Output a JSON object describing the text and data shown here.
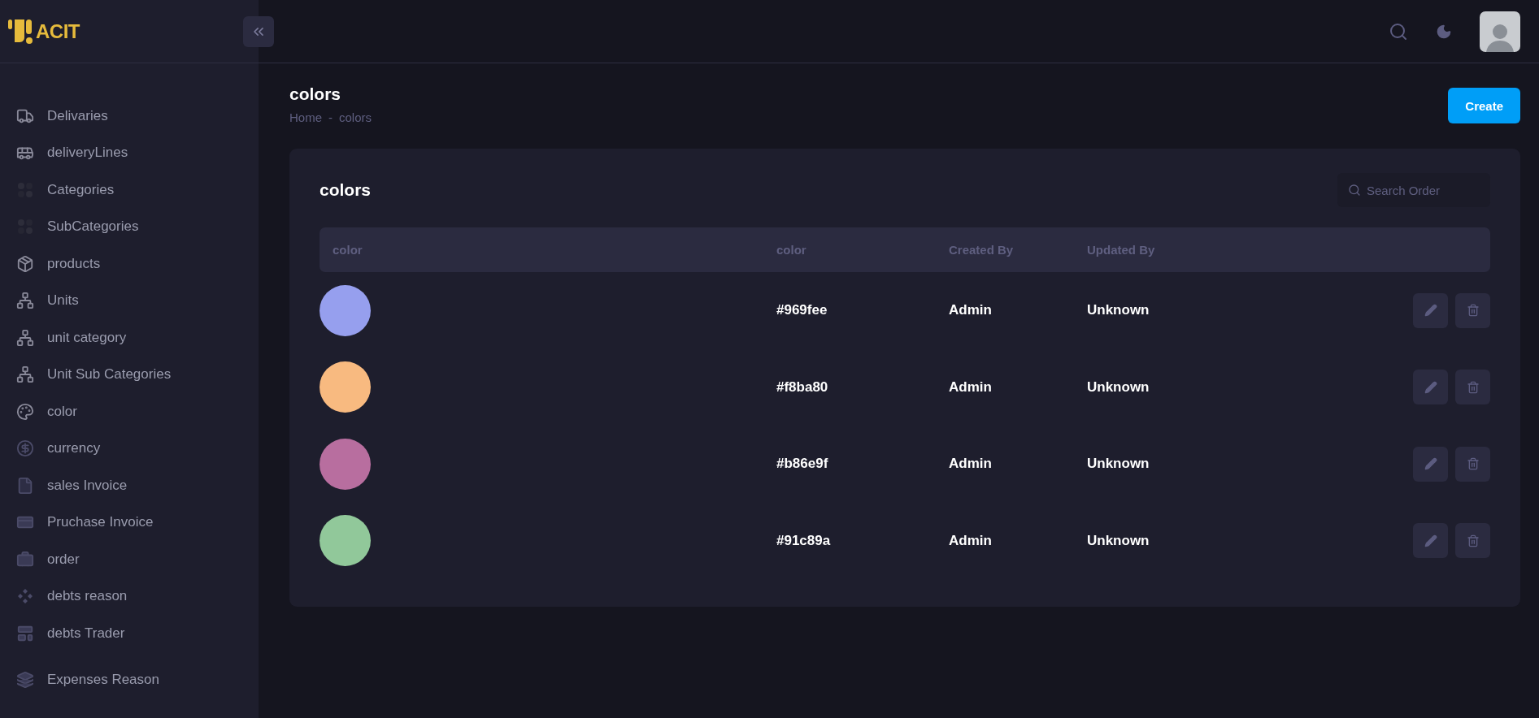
{
  "brand": {
    "name": "ACIT"
  },
  "sidebar": {
    "items": [
      {
        "label": "Delivaries",
        "kind": "truck"
      },
      {
        "label": "deliveryLines",
        "kind": "bus"
      },
      {
        "label": "Categories",
        "kind": "dots"
      },
      {
        "label": "SubCategories",
        "kind": "dots"
      },
      {
        "label": "products",
        "kind": "package"
      },
      {
        "label": "Units",
        "kind": "network"
      },
      {
        "label": "unit category",
        "kind": "network"
      },
      {
        "label": "Unit Sub Categories",
        "kind": "network"
      },
      {
        "label": "color",
        "kind": "palette"
      },
      {
        "label": "currency",
        "kind": "dollar"
      },
      {
        "label": "sales Invoice",
        "kind": "file"
      },
      {
        "label": "Pruchase Invoice",
        "kind": "card"
      },
      {
        "label": "order",
        "kind": "briefcase"
      },
      {
        "label": "debts reason",
        "kind": "diamonds"
      },
      {
        "label": "debts Trader",
        "kind": "layout"
      },
      {
        "label": "Expenses Reason",
        "kind": "layers"
      }
    ]
  },
  "page": {
    "title": "colors",
    "breadcrumb": [
      "Home",
      "colors"
    ],
    "breadcrumb_separator": "-",
    "create_button": "Create"
  },
  "card": {
    "title": "colors",
    "search": {
      "placeholder": "Search Order"
    }
  },
  "table": {
    "columns": [
      "color",
      "color",
      "Created By",
      "Updated By"
    ],
    "rows": [
      {
        "color": "#969fee",
        "hex": "#969fee",
        "created_by": "Admin",
        "updated_by": "Unknown"
      },
      {
        "color": "#f8ba80",
        "hex": "#f8ba80",
        "created_by": "Admin",
        "updated_by": "Unknown"
      },
      {
        "color": "#b86e9f",
        "hex": "#b86e9f",
        "created_by": "Admin",
        "updated_by": "Unknown"
      },
      {
        "color": "#91c89a",
        "hex": "#91c89a",
        "created_by": "Admin",
        "updated_by": "Unknown"
      }
    ]
  }
}
